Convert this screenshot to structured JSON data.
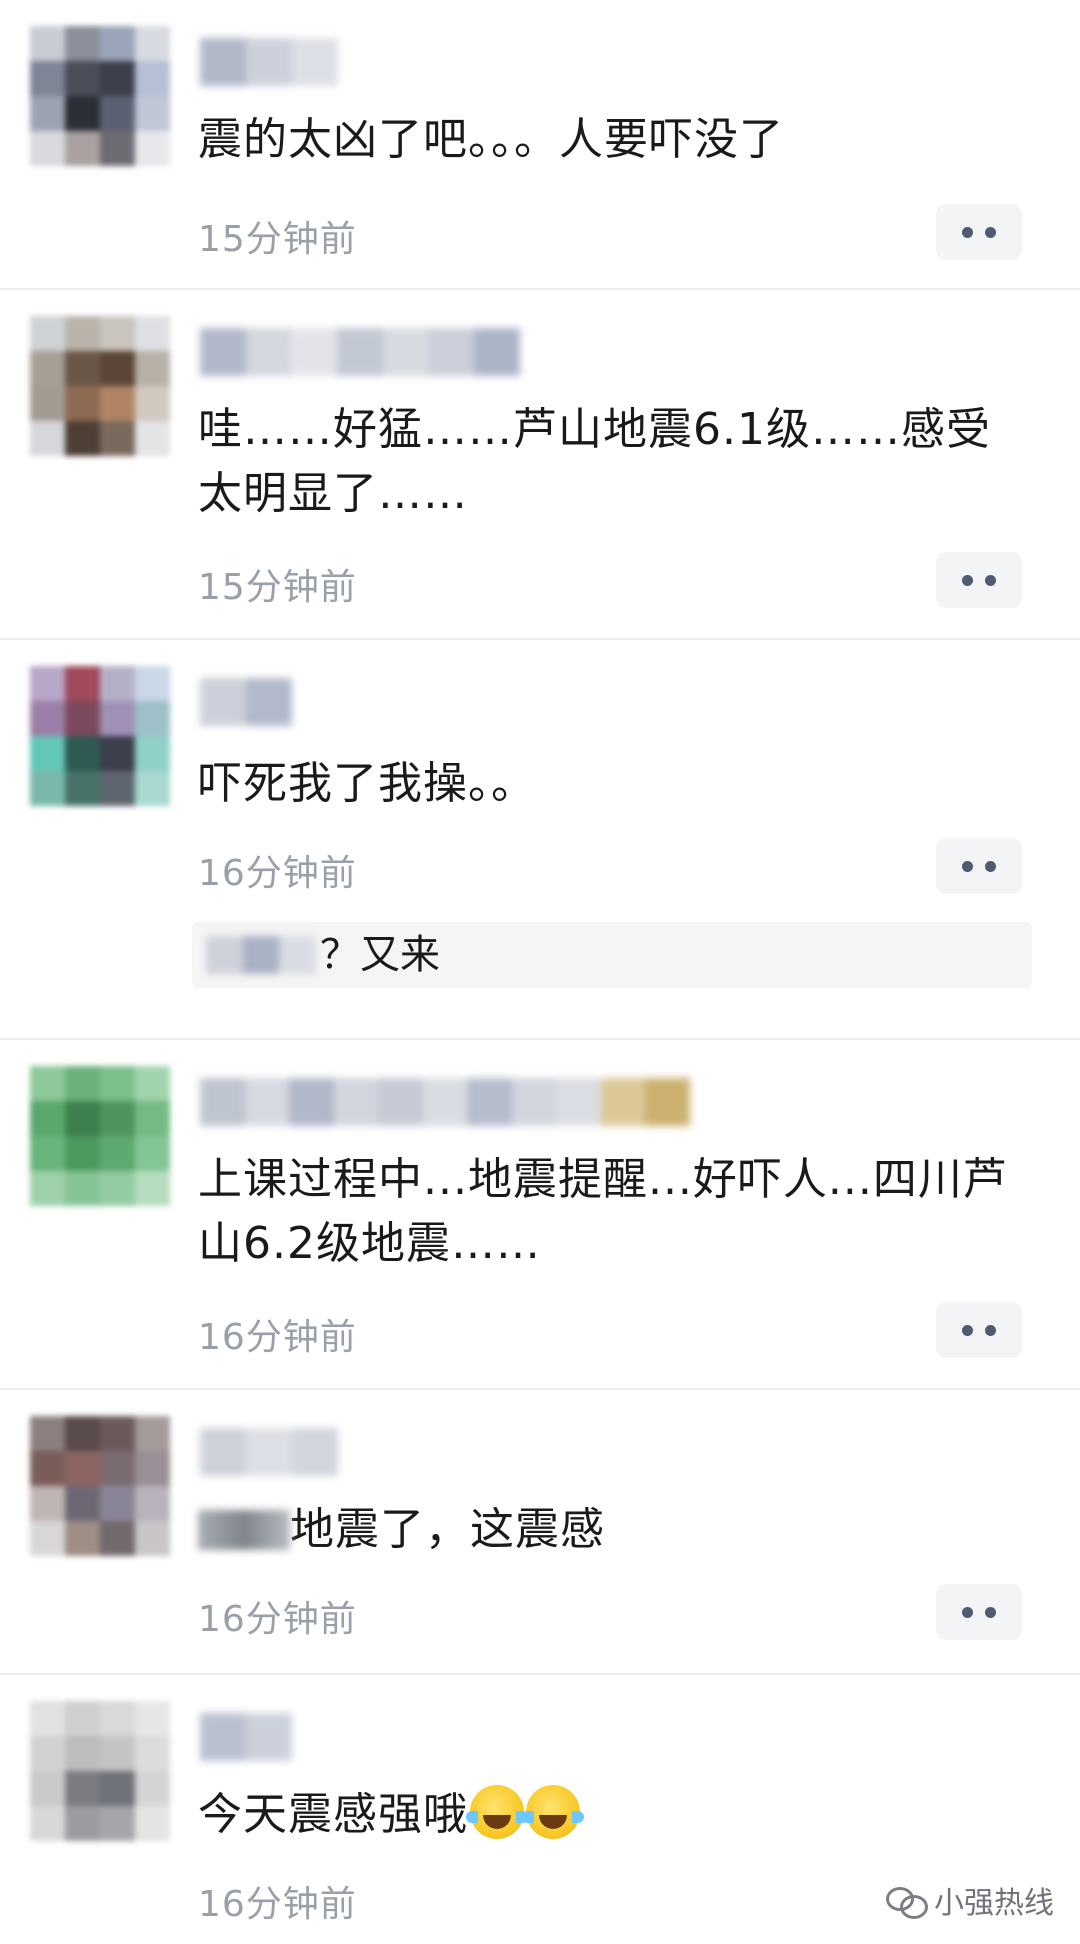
{
  "comments": [
    {
      "text": "震的太凶了吧。。。人要吓没了",
      "time": "15分钟前"
    },
    {
      "text": "哇……好猛……芦山地震6.1级……感受太明显了……",
      "time": "15分钟前"
    },
    {
      "text": "吓死我了我操。。",
      "time": "16分钟前",
      "reply": "？又来"
    },
    {
      "text": "上课过程中...地震提醒...好吓人...四川芦山6.2级地震……",
      "time": "16分钟前"
    },
    {
      "text": "地震了，这震感",
      "time": "16分钟前"
    },
    {
      "text": "今天震感强哦",
      "time": "16分钟前"
    }
  ],
  "icons": {
    "more": "more-dots-icon",
    "emoji": "laugh-cry-emoji-icon",
    "watermark": "wechat-icon"
  },
  "watermark": "小强热线",
  "colors": {
    "time": "#9aa0a8",
    "more_bg": "#f3f4f6",
    "more_dots": "#4e5b70"
  }
}
